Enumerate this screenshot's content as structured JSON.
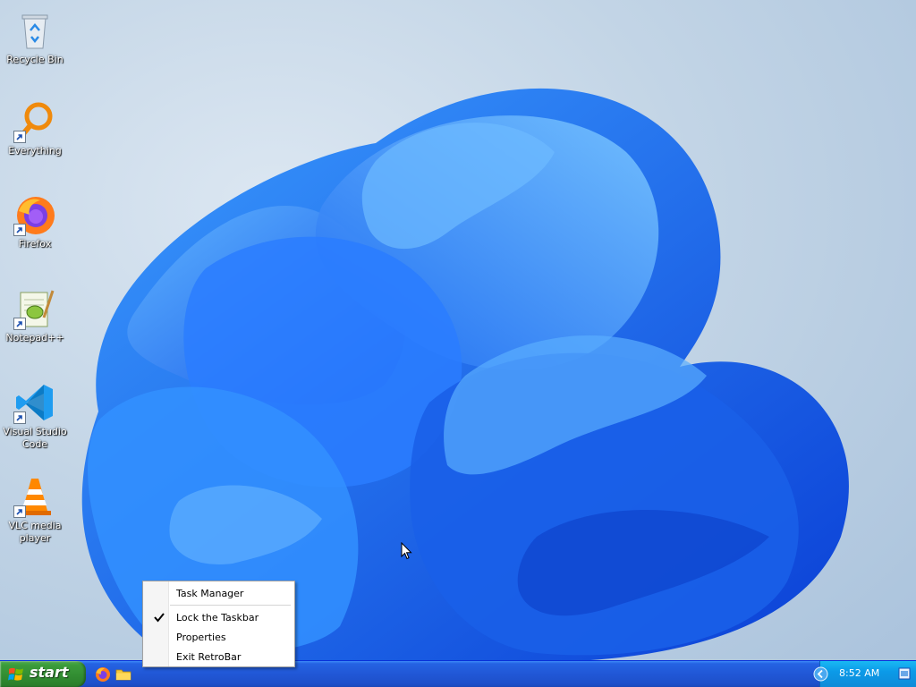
{
  "desktop": {
    "icons": [
      {
        "label": "Recycle Bin",
        "icon": "recycle-bin-icon",
        "shortcut": false
      },
      {
        "label": "Everything",
        "icon": "everything-search-icon",
        "shortcut": true
      },
      {
        "label": "Firefox",
        "icon": "firefox-icon",
        "shortcut": true
      },
      {
        "label": "Notepad++",
        "icon": "notepad-plus-plus-icon",
        "shortcut": true
      },
      {
        "label": "Visual Studio Code",
        "icon": "vscode-icon",
        "shortcut": true
      },
      {
        "label": "VLC media player",
        "icon": "vlc-icon",
        "shortcut": true
      }
    ]
  },
  "context_menu": {
    "items": [
      {
        "label": "Task Manager",
        "checked": false
      },
      {
        "label": "Lock the Taskbar",
        "checked": true
      },
      {
        "label": "Properties",
        "checked": false
      },
      {
        "label": "Exit RetroBar",
        "checked": false
      }
    ]
  },
  "taskbar": {
    "start_label": "start",
    "quick_launch": [
      "firefox-icon",
      "folder-icon"
    ],
    "clock": "8:52 AM",
    "colors": {
      "taskbar": "#2157d6",
      "start": "#318c31",
      "tray": "#0c9ae8"
    }
  }
}
